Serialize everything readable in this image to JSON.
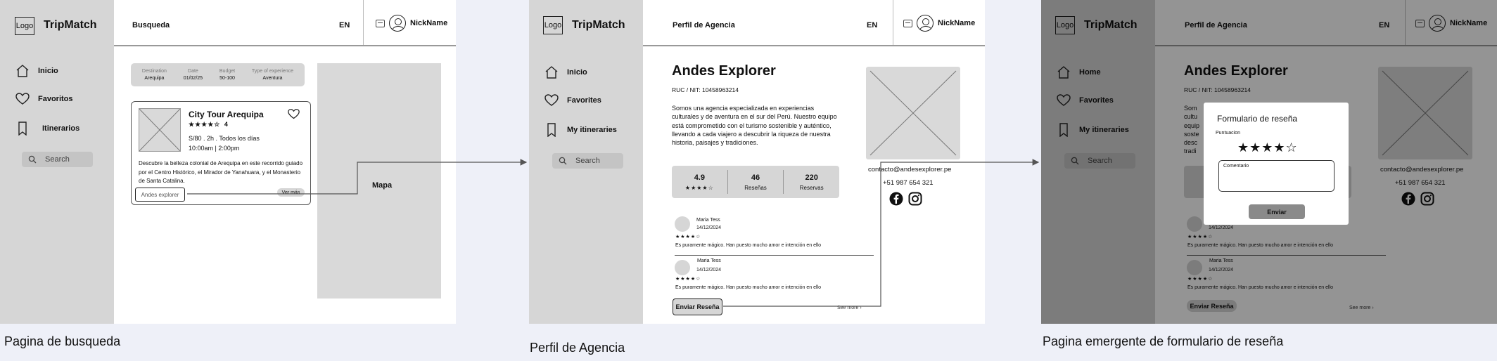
{
  "common": {
    "logo": "Logo",
    "brand": "TripMatch",
    "lang": "EN",
    "username": "NickName",
    "search_label": "Search"
  },
  "screen1": {
    "topbar_title": "Busqueda",
    "nav": [
      "Inicio",
      "Favoritos",
      "Itinerarios"
    ],
    "filters": [
      {
        "label": "Destination",
        "value": "Arequipa"
      },
      {
        "label": "Date",
        "value": "01/02/25"
      },
      {
        "label": "Budget",
        "value": "50-100"
      },
      {
        "label": "Type of experience",
        "value": "Aventura"
      }
    ],
    "result": {
      "title": "City Tour Arequipa",
      "stars": "★★★★☆",
      "rating": "4",
      "price_line": "S/80 . 2h . Todos los días",
      "schedule": "10:00am | 2:00pm",
      "description": "Descubre la belleza colonial de Arequipa en este recorrido guiado por el Centro Histórico, el Mirador de Yanahuara, y el Monasterio de Santa Catalina.",
      "agency_link": "Andes explorer",
      "more_link": "Ver más"
    },
    "map_label": "Mapa",
    "caption": "Pagina de busqueda"
  },
  "screen2": {
    "topbar_title": "Perfil de Agencia",
    "nav": [
      "Inicio",
      "Favorites",
      "My itineraries"
    ],
    "agency_name": "Andes Explorer",
    "ruc": "RUC / NIT: 10458963214",
    "description": "Somos una agencia especializada en experiencias culturales y de aventura en el sur del Perú. Nuestro equipo está comprometido con el turismo sostenible y auténtico, llevando a cada viajero a descubrir la riqueza de nuestra historia, paisajes y tradiciones.",
    "stats": [
      {
        "value": "4.9",
        "label": "★★★★☆"
      },
      {
        "value": "46",
        "label": "Reseñas"
      },
      {
        "value": "220",
        "label": "Reservas"
      }
    ],
    "email": "contacto@andesexplorer.pe",
    "phone": "+51 987 654 321",
    "reviews": [
      {
        "name": "Maria Tess",
        "date": "14/12/2024",
        "stars": "★★★★☆",
        "text": "Es puramente mágico. Han puesto mucho amor e intención en ello"
      },
      {
        "name": "Maria Tess",
        "date": "14/12/2024",
        "stars": "★★★★☆",
        "text": "Es puramente mágico. Han puesto mucho amor e intención en ello"
      }
    ],
    "review_button": "Enviar Reseña",
    "see_more": "See more",
    "caption": "Perfil de Agencia"
  },
  "screen3": {
    "topbar_title": "Perfil de Agencia",
    "nav": [
      "Home",
      "Favorites",
      "My itineraries"
    ],
    "agency_name": "Andes Explorer",
    "ruc": "RUC / NIT: 10458963214",
    "email": "contacto@andesexplorer.pe",
    "phone": "+51 987 654 321",
    "desc_fragments": [
      "Som",
      "cultu",
      "equip",
      "soste",
      "desc",
      "tradi"
    ],
    "review_date": "14/12/2024",
    "review_stars": "★★★★☆",
    "review_text": "Es puramente mágico. Han puesto mucho amor e intención en ello",
    "review2_name": "Maria Tess",
    "review2_date": "14/12/2024",
    "review2_stars": "★★★★☆",
    "review2_text": "Es puramente mágico. Han puesto mucho amor e intención en ello",
    "review_button": "Enviar Reseña",
    "see_more": "See more",
    "modal": {
      "title": "Formulario de reseña",
      "rating_label": "Puntuacion",
      "stars": "★★★★☆",
      "comment_label": "Comentario",
      "submit": "Enviar"
    },
    "caption": "Pagina emergente de formulario de reseña"
  }
}
